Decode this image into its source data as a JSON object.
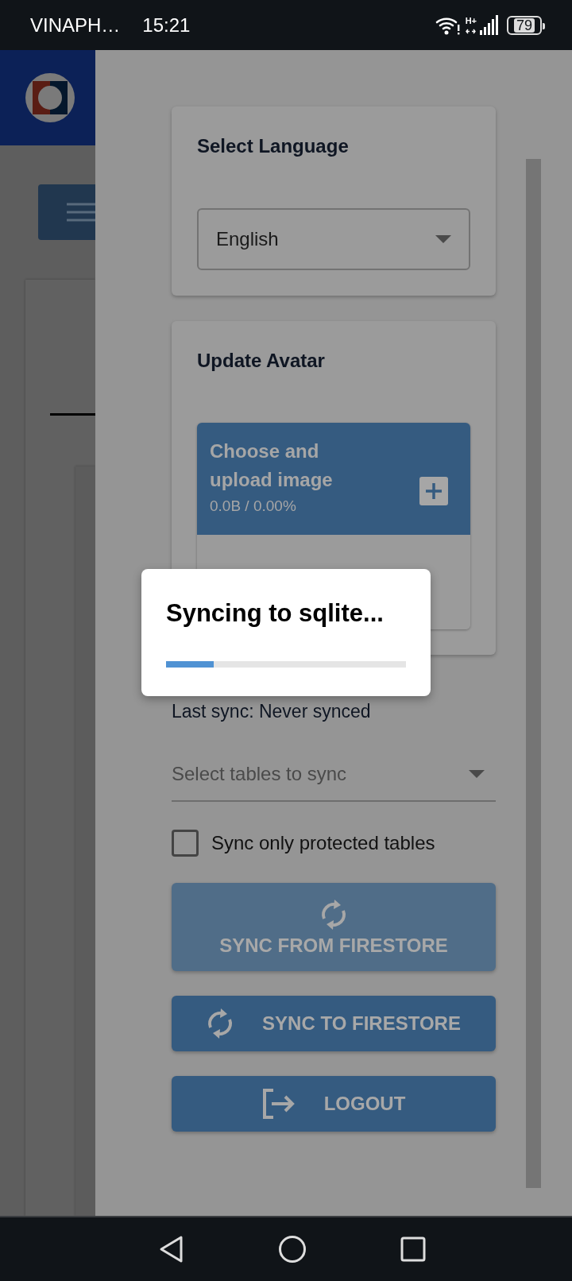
{
  "status_bar": {
    "carrier": "VINAPH…",
    "time": "15:21",
    "battery": "79",
    "network": "H+"
  },
  "drawer": {
    "language_card": {
      "title": "Select Language",
      "select": {
        "value": "English"
      }
    },
    "avatar_card": {
      "title": "Update Avatar",
      "upload": {
        "label": "Choose and upload image",
        "progress": "0.0B / 0.00%"
      }
    },
    "last_sync": "Last sync: Never synced",
    "tables_select": {
      "placeholder": "Select tables to sync"
    },
    "protected_checkbox": {
      "label": "Sync only protected tables",
      "checked": false
    },
    "buttons": [
      {
        "label": "SYNC FROM FIRESTORE",
        "kind": "stacked",
        "disabled": true
      },
      {
        "label": "SYNC TO FIRESTORE",
        "kind": "sync",
        "disabled": false
      },
      {
        "label": "LOGOUT",
        "kind": "logout",
        "disabled": false
      }
    ]
  },
  "dialog": {
    "title": "Syncing to sqlite...",
    "level": 0.2
  }
}
